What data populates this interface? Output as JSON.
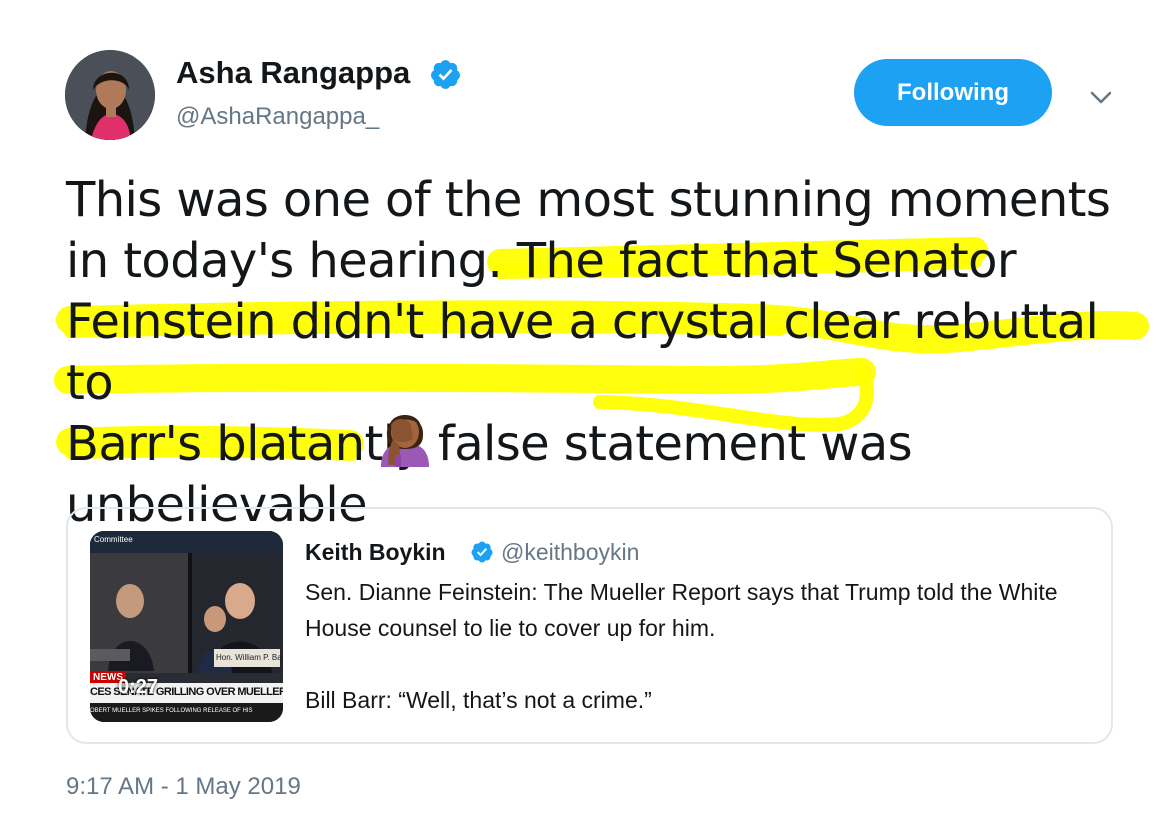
{
  "author": {
    "name": "Asha Rangappa",
    "handle": "@AshaRangappa_",
    "verified": true
  },
  "follow_button": {
    "label": "Following"
  },
  "tweet": {
    "lines": [
      "This was one of the most stunning moments",
      "in today's hearing. The fact that Senator",
      "Feinstein didn't have a crystal clear rebuttal to",
      "Barr's blatantly false statement was",
      "unbelievable"
    ],
    "emoji": "🤦🏾‍♀️",
    "highlight_color": "#ffff00"
  },
  "quoted_tweet": {
    "name": "Keith Boykin",
    "handle": "@keithboykin",
    "paragraph_1": "Sen. Dianne Feinstein: The Mueller Report says that Trump told the White House counsel to lie to cover up for him.",
    "paragraph_2": "Bill Barr: “Well, that’s not a crime.”",
    "video": {
      "duration": "0:27",
      "corner_label": "Committee",
      "nameplate": "Hon. William P. Barr",
      "news_tag": "NEWS",
      "headline": "CES SENATE GRILLING OVER MUELLER REP",
      "ticker": "OBERT MUELLER SPIKES FOLLOWING RELEASE OF HIS"
    }
  },
  "timestamp": "9:17 AM - 1 May 2019",
  "colors": {
    "accent": "#1da1f2",
    "secondary_text": "#657786",
    "border": "#e1e8ed"
  }
}
